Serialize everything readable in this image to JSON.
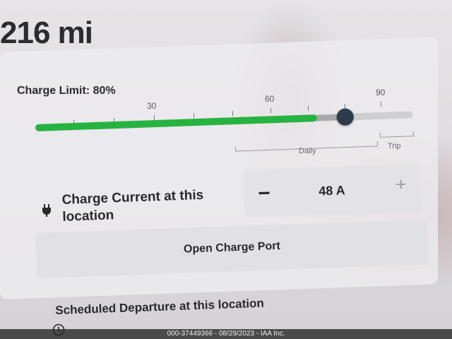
{
  "range": "216 mi",
  "charge_limit": {
    "label": "Charge Limit: 80%",
    "value_percent": 80,
    "ticks": {
      "t30": "30",
      "t60": "60",
      "t90": "90"
    },
    "daily_label": "Daily",
    "trip_label": "Trip",
    "fill_color": "#27b341"
  },
  "charge_current": {
    "label": "Charge Current at this location",
    "value": "48 A",
    "minus": "−",
    "plus": "+",
    "icon": "plug-icon"
  },
  "open_charge_port": "Open Charge Port",
  "scheduled_departure": "Scheduled Departure at this location",
  "footer": "000-37449366 - 08/29/2023 - IAA Inc."
}
